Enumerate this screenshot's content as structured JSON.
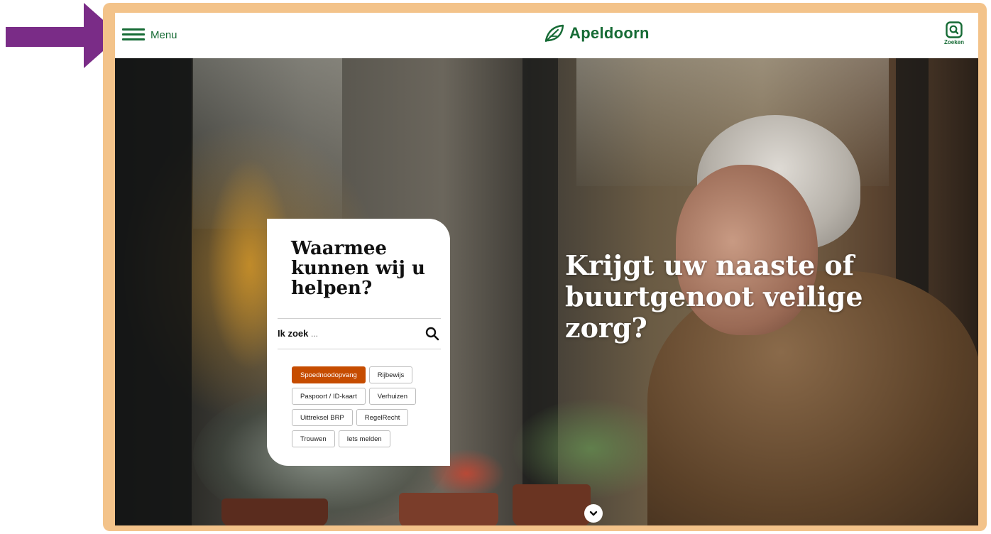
{
  "header": {
    "menu_label": "Menu",
    "logo_text": "Apeldoorn",
    "search_label": "Zoeken"
  },
  "search_card": {
    "title": "Waarmee kunnen wij u helpen?",
    "search_label": "Ik zoek",
    "search_placeholder": "...",
    "chips": [
      {
        "label": "Spoednoodopvang",
        "active": true
      },
      {
        "label": "Rijbewijs",
        "active": false
      },
      {
        "label": "Paspoort / ID-kaart",
        "active": false
      },
      {
        "label": "Verhuizen",
        "active": false
      },
      {
        "label": "Uittreksel BRP",
        "active": false
      },
      {
        "label": "RegelRecht",
        "active": false
      },
      {
        "label": "Trouwen",
        "active": false
      },
      {
        "label": "Iets melden",
        "active": false
      }
    ]
  },
  "hero": {
    "headline": "Krijgt uw naaste of buurtgenoot veilige zorg?"
  },
  "icons": {
    "menu": "hamburger-icon",
    "logo": "leaf-logo-icon",
    "search": "search-icon",
    "scroll": "chevron-down-icon",
    "annotation": "arrow-right-icon"
  },
  "colors": {
    "brand_green": "#166b35",
    "accent_orange": "#c64c00",
    "frame": "#f3c38a",
    "annotation_arrow": "#7a2c87"
  }
}
